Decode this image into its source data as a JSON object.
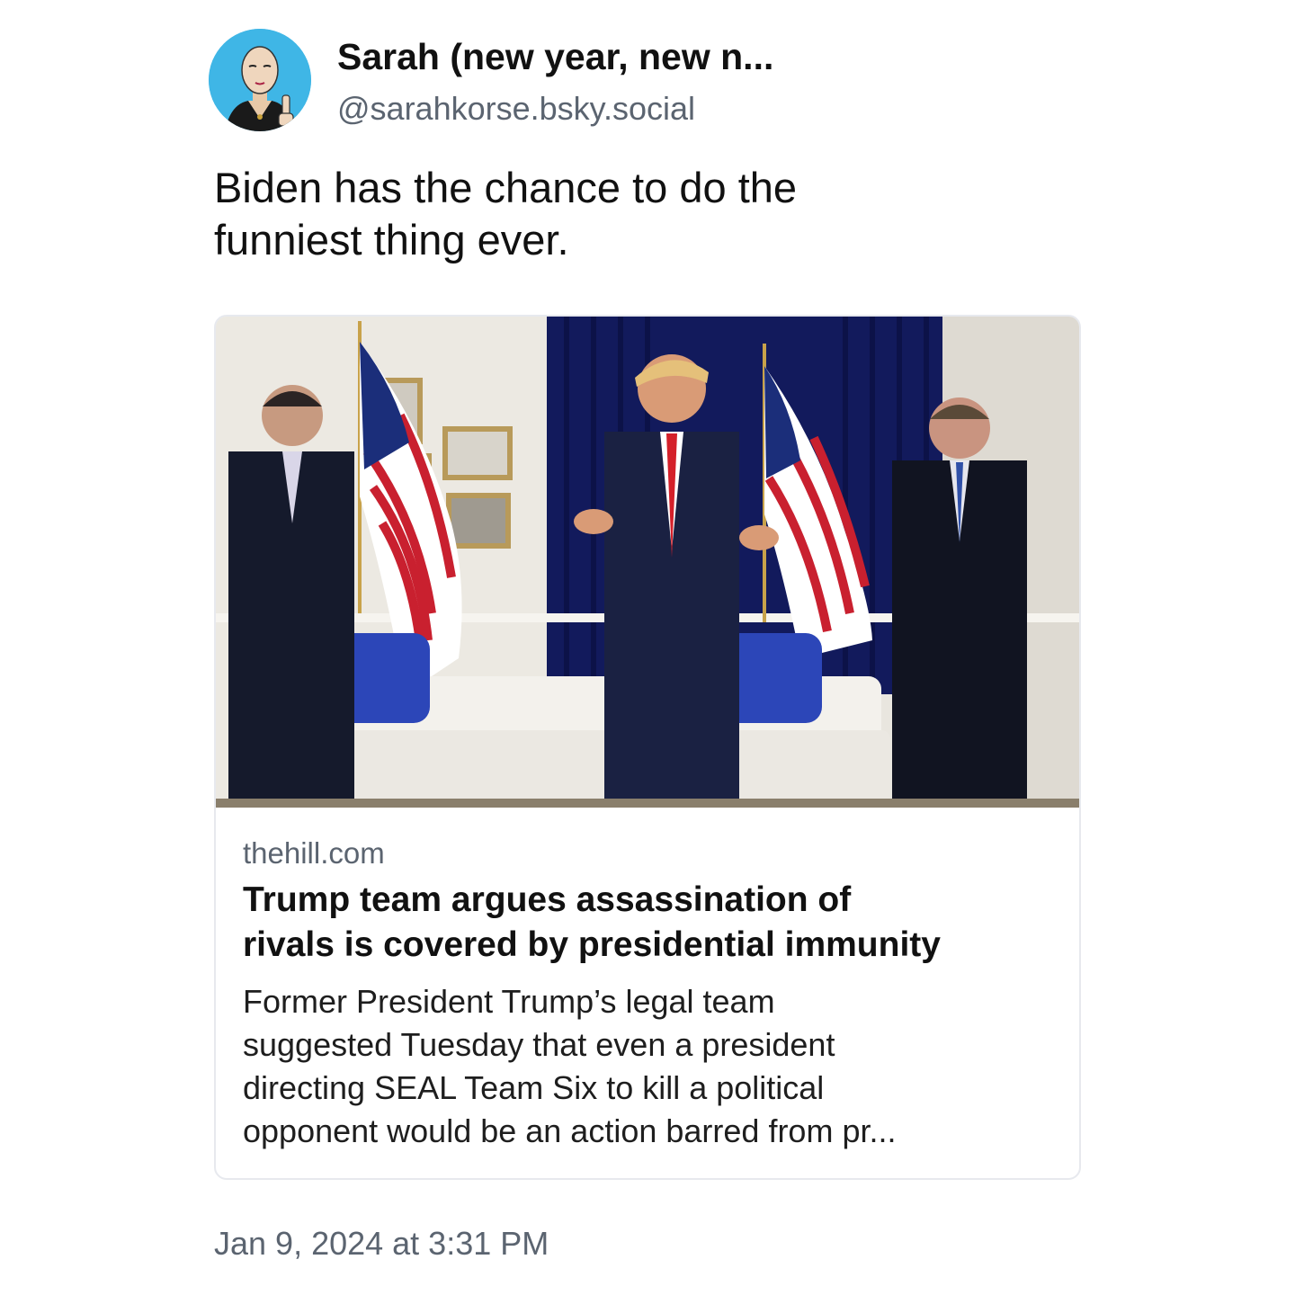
{
  "author": {
    "display_name": "Sarah (new year, new n...",
    "handle": "@sarahkorse.bsky.social",
    "avatar_icon": "cartoon-avatar-icon"
  },
  "post": {
    "text_lines": [
      "Biden has the chance to do the",
      "funniest thing ever."
    ]
  },
  "link_card": {
    "domain": "thehill.com",
    "title_lines": [
      "Trump team argues assassination of",
      "rivals is covered by presidential immunity"
    ],
    "description_lines": [
      "Former President Trump’s legal team",
      "suggested Tuesday that even a president",
      "directing SEAL Team Six to kill a political",
      "opponent would be an action barred from pr..."
    ]
  },
  "timestamp": "Jan 9, 2024 at 3:31 PM",
  "colors": {
    "avatar_bg": "#3fb6e6",
    "secondary_text": "#5b6470",
    "card_border": "#e7e9ee",
    "curtain": "#121a5c"
  }
}
